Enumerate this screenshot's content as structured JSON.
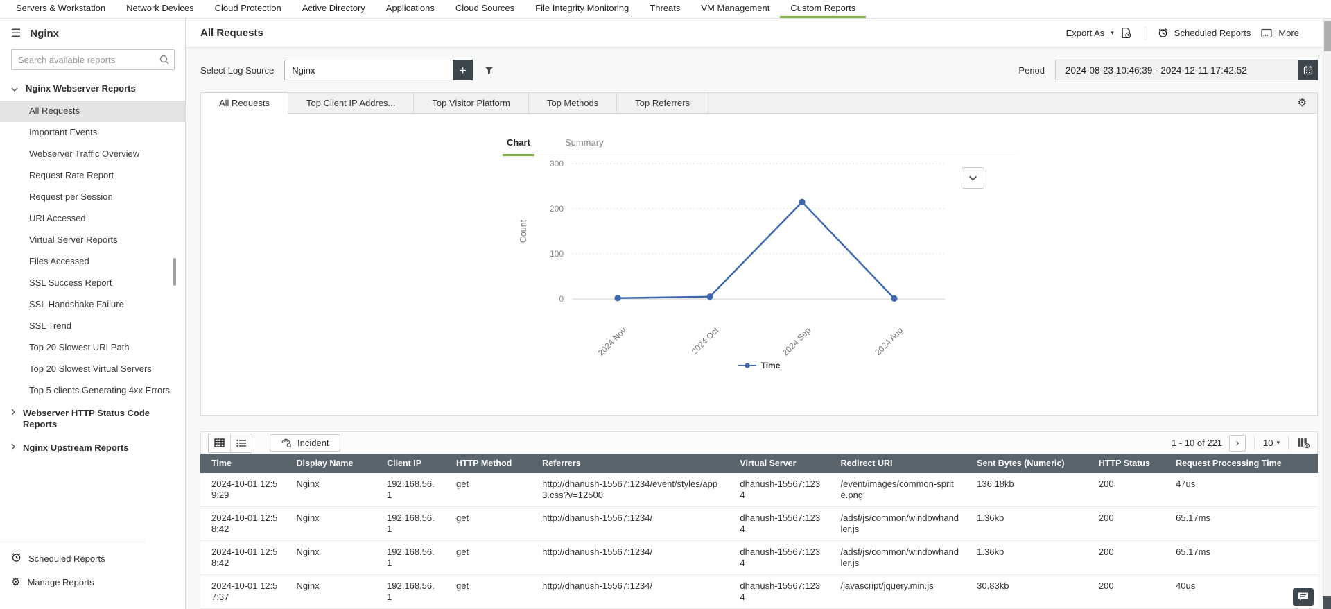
{
  "colors": {
    "accent": "#7cb43f",
    "chart_line": "#3e68b0",
    "table_header_bg": "#5a646c"
  },
  "nav": {
    "items": [
      "Servers & Workstation",
      "Network Devices",
      "Cloud Protection",
      "Active Directory",
      "Applications",
      "Cloud Sources",
      "File Integrity Monitoring",
      "Threats",
      "VM Management",
      "Custom Reports"
    ],
    "active": "Custom Reports"
  },
  "sidebar": {
    "title": "Nginx",
    "search_placeholder": "Search available reports",
    "group_label": "Nginx Webserver Reports",
    "items": [
      "All Requests",
      "Important Events",
      "Webserver Traffic Overview",
      "Request Rate Report",
      "Request per Session",
      "URI Accessed",
      "Virtual Server Reports",
      "Files Accessed",
      "SSL Success Report",
      "SSL Handshake Failure",
      "SSL Trend",
      "Top 20 Slowest URI Path",
      "Top 20 Slowest Virtual Servers",
      "Top 5 clients Generating 4xx Errors"
    ],
    "selected_item": "All Requests",
    "collapsed_groups": [
      "Webserver HTTP Status Code Reports",
      "Nginx Upstream Reports"
    ],
    "footer_items": [
      {
        "icon": "alarm-clock-icon",
        "label": "Scheduled Reports"
      },
      {
        "icon": "gear-icon",
        "label": "Manage Reports"
      }
    ]
  },
  "header": {
    "title": "All Requests",
    "actions": {
      "export": "Export As",
      "scheduled": "Scheduled Reports",
      "more": "More"
    }
  },
  "filters": {
    "log_source_label": "Select Log Source",
    "log_source_value": "Nginx",
    "period_label": "Period",
    "period_value": "2024-08-23 10:46:39 - 2024-12-11 17:42:52"
  },
  "tabs": {
    "items": [
      "All Requests",
      "Top Client IP Addres...",
      "Top Visitor Platform",
      "Top Methods",
      "Top Referrers"
    ],
    "active": "All Requests"
  },
  "view_toggle": {
    "options": [
      "Chart",
      "Summary"
    ],
    "active": "Chart"
  },
  "chart_data": {
    "type": "line",
    "x": [
      "2024 Nov",
      "2024 Oct",
      "2024 Sep",
      "2024 Aug"
    ],
    "series": [
      {
        "name": "Time",
        "values": [
          2,
          5,
          215,
          1
        ]
      }
    ],
    "title": "",
    "xlabel": "",
    "ylabel": "Count",
    "yticks": [
      0,
      100,
      200,
      300
    ],
    "ylim": [
      0,
      300
    ],
    "grid": true,
    "legend_position": "bottom"
  },
  "table": {
    "incident_label": "Incident",
    "pagination": {
      "range_text": "1 - 10 of 221",
      "next": "›",
      "page_size": "10"
    },
    "columns": [
      "Time",
      "Display Name",
      "Client IP",
      "HTTP Method",
      "Referrers",
      "Virtual Server",
      "Redirect URI",
      "Sent Bytes (Numeric)",
      "HTTP Status",
      "Request Processing Time"
    ],
    "rows": [
      [
        "2024-10-01 12:59:29",
        "Nginx",
        "192.168.56.1",
        "get",
        "http://dhanush-15567:1234/event/styles/app3.css?v=12500",
        "dhanush-15567:1234",
        "/event/images/common-sprite.png",
        "136.18kb",
        "200",
        "47us"
      ],
      [
        "2024-10-01 12:58:42",
        "Nginx",
        "192.168.56.1",
        "get",
        "http://dhanush-15567:1234/",
        "dhanush-15567:1234",
        "/adsf/js/common/windowhandler.js",
        "1.36kb",
        "200",
        "65.17ms"
      ],
      [
        "2024-10-01 12:58:42",
        "Nginx",
        "192.168.56.1",
        "get",
        "http://dhanush-15567:1234/",
        "dhanush-15567:1234",
        "/adsf/js/common/windowhandler.js",
        "1.36kb",
        "200",
        "65.17ms"
      ],
      [
        "2024-10-01 12:57:37",
        "Nginx",
        "192.168.56.1",
        "get",
        "http://dhanush-15567:1234/",
        "dhanush-15567:1234",
        "/javascript/jquery.min.js",
        "30.83kb",
        "200",
        "40us"
      ]
    ]
  }
}
